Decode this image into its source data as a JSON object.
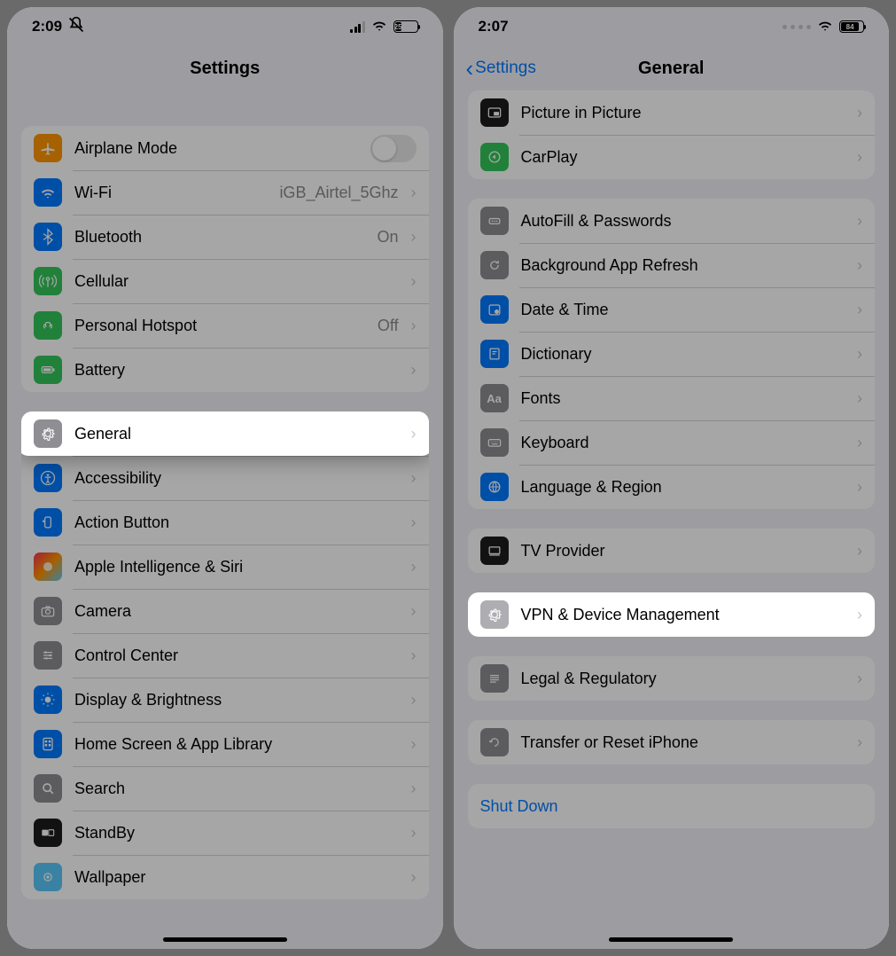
{
  "left": {
    "status": {
      "time": "2:09",
      "battery": "25"
    },
    "title": "Settings",
    "sections": [
      {
        "rows": [
          {
            "icon": "airplane",
            "color": "bg-orange",
            "label": "Airplane Mode",
            "control": "toggle"
          },
          {
            "icon": "wifi",
            "color": "bg-blue",
            "label": "Wi-Fi",
            "detail": "iGB_Airtel_5Ghz",
            "chevron": true
          },
          {
            "icon": "bluetooth",
            "color": "bg-blue",
            "label": "Bluetooth",
            "detail": "On",
            "chevron": true
          },
          {
            "icon": "antenna",
            "color": "bg-green",
            "label": "Cellular",
            "chevron": true
          },
          {
            "icon": "link",
            "color": "bg-green",
            "label": "Personal Hotspot",
            "detail": "Off",
            "chevron": true
          },
          {
            "icon": "battery",
            "color": "bg-green",
            "label": "Battery",
            "chevron": true
          }
        ]
      },
      {
        "rows": [
          {
            "icon": "gear",
            "color": "bg-gray",
            "label": "General",
            "chevron": true,
            "highlight": true
          },
          {
            "icon": "accessibility",
            "color": "bg-blue",
            "label": "Accessibility",
            "chevron": true
          },
          {
            "icon": "action",
            "color": "bg-blue",
            "label": "Action Button",
            "chevron": true
          },
          {
            "icon": "siri",
            "color": "bg-grad",
            "label": "Apple Intelligence & Siri",
            "chevron": true
          },
          {
            "icon": "camera",
            "color": "bg-gray",
            "label": "Camera",
            "chevron": true
          },
          {
            "icon": "control",
            "color": "bg-gray",
            "label": "Control Center",
            "chevron": true
          },
          {
            "icon": "brightness",
            "color": "bg-blue",
            "label": "Display & Brightness",
            "chevron": true
          },
          {
            "icon": "grid",
            "color": "bg-blue",
            "label": "Home Screen & App Library",
            "chevron": true
          },
          {
            "icon": "search",
            "color": "bg-gray",
            "label": "Search",
            "chevron": true
          },
          {
            "icon": "standby",
            "color": "bg-black",
            "label": "StandBy",
            "chevron": true
          },
          {
            "icon": "wallpaper",
            "color": "bg-blue",
            "label": "Wallpaper",
            "chevron": true
          }
        ]
      }
    ]
  },
  "right": {
    "status": {
      "time": "2:07",
      "battery": "84"
    },
    "back": "Settings",
    "title": "General",
    "sections": [
      {
        "rows": [
          {
            "icon": "pip",
            "color": "bg-black",
            "label": "Picture in Picture",
            "chevron": true
          },
          {
            "icon": "carplay",
            "color": "bg-green",
            "label": "CarPlay",
            "chevron": true
          }
        ]
      },
      {
        "rows": [
          {
            "icon": "password",
            "color": "bg-gray",
            "label": "AutoFill & Passwords",
            "chevron": true
          },
          {
            "icon": "refresh",
            "color": "bg-gray",
            "label": "Background App Refresh",
            "chevron": true
          },
          {
            "icon": "calendar",
            "color": "bg-blue",
            "label": "Date & Time",
            "chevron": true
          },
          {
            "icon": "dictionary",
            "color": "bg-blue",
            "label": "Dictionary",
            "chevron": true
          },
          {
            "icon": "fonts",
            "color": "bg-gray",
            "label": "Fonts",
            "chevron": true
          },
          {
            "icon": "keyboard",
            "color": "bg-gray",
            "label": "Keyboard",
            "chevron": true
          },
          {
            "icon": "globe",
            "color": "bg-blue",
            "label": "Language & Region",
            "chevron": true
          }
        ]
      },
      {
        "rows": [
          {
            "icon": "tv",
            "color": "bg-black",
            "label": "TV Provider",
            "chevron": true
          }
        ]
      },
      {
        "rows": [
          {
            "icon": "gear",
            "color": "bg-lightgray",
            "label": "VPN & Device Management",
            "chevron": true,
            "highlight": true
          }
        ]
      },
      {
        "rows": [
          {
            "icon": "legal",
            "color": "bg-gray",
            "label": "Legal & Regulatory",
            "chevron": true
          }
        ]
      },
      {
        "rows": [
          {
            "icon": "reset",
            "color": "bg-gray",
            "label": "Transfer or Reset iPhone",
            "chevron": true
          }
        ]
      },
      {
        "rows": [
          {
            "label": "Shut Down",
            "link": true
          }
        ]
      }
    ]
  }
}
